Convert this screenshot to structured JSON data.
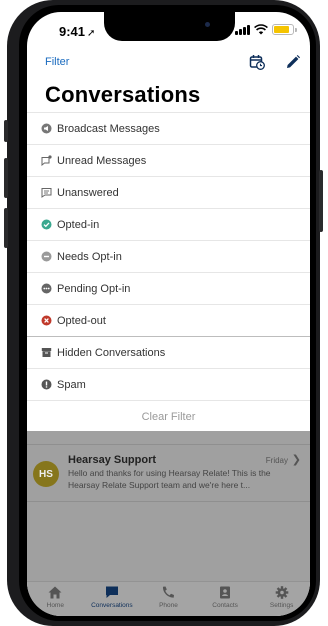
{
  "status_bar": {
    "time": "9:41"
  },
  "header": {
    "filter_label": "Filter",
    "title": "Conversations"
  },
  "filters": [
    {
      "label": "Broadcast Messages",
      "icon": "broadcast-icon"
    },
    {
      "label": "Unread Messages",
      "icon": "unread-icon"
    },
    {
      "label": "Unanswered",
      "icon": "unanswered-icon"
    },
    {
      "label": "Opted-in",
      "icon": "check-circle-icon",
      "color": "#3aa88f"
    },
    {
      "label": "Needs Opt-in",
      "icon": "minus-circle-icon",
      "color": "#9a9a9a"
    },
    {
      "label": "Pending Opt-in",
      "icon": "dots-circle-icon",
      "color": "#666666"
    },
    {
      "label": "Opted-out",
      "icon": "x-circle-icon",
      "color": "#c0392b"
    },
    {
      "label": "Hidden Conversations",
      "icon": "archive-icon"
    },
    {
      "label": "Spam",
      "icon": "alert-circle-icon"
    }
  ],
  "clear_filter_label": "Clear Filter",
  "conversation": {
    "initials": "HS",
    "name": "Hearsay Support",
    "time": "Friday",
    "preview": "Hello and thanks for using Hearsay Relate! This is the Hearsay Relate Support team and we're here t..."
  },
  "tabs": [
    {
      "label": "Home",
      "icon": "home-icon"
    },
    {
      "label": "Conversations",
      "icon": "chat-icon",
      "active": true
    },
    {
      "label": "Phone",
      "icon": "phone-icon"
    },
    {
      "label": "Contacts",
      "icon": "contacts-icon"
    },
    {
      "label": "Settings",
      "icon": "gear-icon"
    }
  ],
  "colors": {
    "accent": "#1a6bbf",
    "tab_active": "#0e2f5a",
    "avatar": "#86761c"
  }
}
